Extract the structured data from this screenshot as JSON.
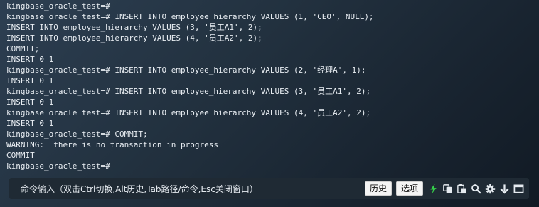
{
  "terminal": {
    "lines": [
      "kingbase_oracle_test=#",
      "kingbase_oracle_test=# INSERT INTO employee_hierarchy VALUES (1, 'CEO', NULL);",
      "INSERT INTO employee_hierarchy VALUES (3, '员工A1', 2);",
      "INSERT INTO employee_hierarchy VALUES (4, '员工A2', 2);",
      "COMMIT;",
      "INSERT 0 1",
      "kingbase_oracle_test=# INSERT INTO employee_hierarchy VALUES (2, '经理A', 1);",
      "INSERT 0 1",
      "kingbase_oracle_test=# INSERT INTO employee_hierarchy VALUES (3, '员工A1', 2);",
      "INSERT 0 1",
      "kingbase_oracle_test=# INSERT INTO employee_hierarchy VALUES (4, '员工A2', 2);",
      "INSERT 0 1",
      "kingbase_oracle_test=# COMMIT;",
      "WARNING:  there is no transaction in progress",
      "COMMIT",
      "kingbase_oracle_test=#"
    ]
  },
  "command_bar": {
    "hint": "命令输入（双击Ctrl切换,Alt历史,Tab路径/命令,Esc关闭窗口）",
    "history_label": "历史",
    "options_label": "选项"
  },
  "icons": {
    "run": "lightning-icon",
    "copy": "copy-icon",
    "paste": "paste-icon",
    "search": "search-icon",
    "settings": "gear-icon",
    "download": "arrow-down-icon",
    "window": "window-icon"
  },
  "colors": {
    "terminal_text": "#e8edf2",
    "lightning": "#35d04a",
    "command_bar_bg": "#1f2a34"
  }
}
